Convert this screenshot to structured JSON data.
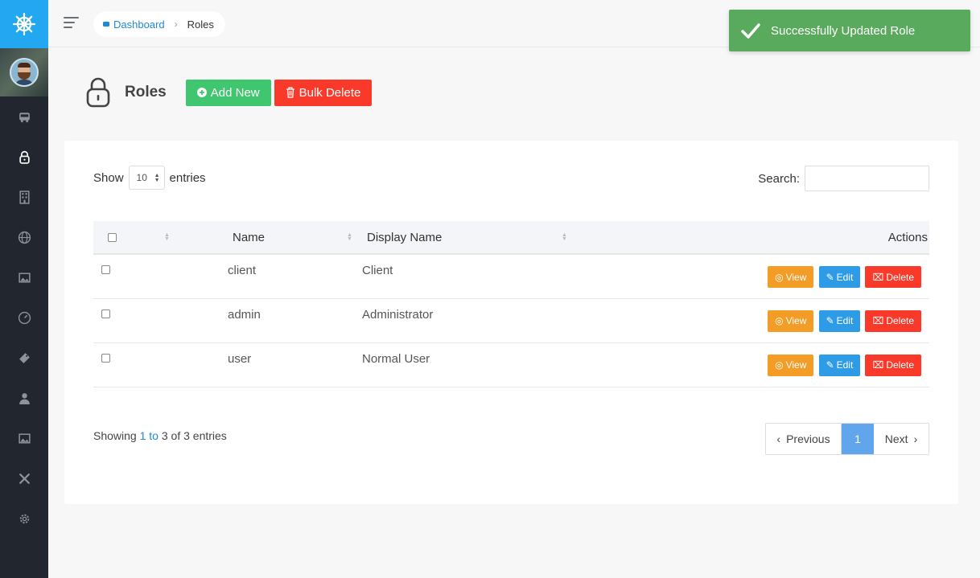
{
  "sidebar": {
    "brand_icon": "ship-wheel-icon",
    "brand_color": "#22a7f0",
    "items": [
      {
        "name": "sidebar-item-bus",
        "icon": "bus-icon"
      },
      {
        "name": "sidebar-item-roles",
        "icon": "lock-icon",
        "active": true
      },
      {
        "name": "sidebar-item-building",
        "icon": "building-icon"
      },
      {
        "name": "sidebar-item-globe",
        "icon": "globe-icon"
      },
      {
        "name": "sidebar-item-media",
        "icon": "image-icon"
      },
      {
        "name": "sidebar-item-dashboard",
        "icon": "gauge-icon"
      },
      {
        "name": "sidebar-item-ticket",
        "icon": "ticket-icon"
      },
      {
        "name": "sidebar-item-users",
        "icon": "user-icon"
      },
      {
        "name": "sidebar-item-gallery",
        "icon": "image-icon"
      },
      {
        "name": "sidebar-item-tools",
        "icon": "tools-icon"
      },
      {
        "name": "sidebar-item-settings",
        "icon": "gear-icon"
      }
    ]
  },
  "topbar": {
    "breadcrumb": {
      "home": "Dashboard",
      "current": "Roles"
    }
  },
  "toast": {
    "message": "Successfully Updated Role",
    "color": "#5aaa5d"
  },
  "page": {
    "title": "Roles",
    "add_label": "Add New",
    "bulk_delete_label": "Bulk Delete"
  },
  "table_controls": {
    "show_label": "Show",
    "entries_value": "10",
    "entries_label": "entries",
    "search_label": "Search:"
  },
  "table": {
    "headers": {
      "name": "Name",
      "display_name": "Display Name",
      "actions": "Actions"
    },
    "rows": [
      {
        "name": "client",
        "display_name": "Client"
      },
      {
        "name": "admin",
        "display_name": "Administrator"
      },
      {
        "name": "user",
        "display_name": "Normal User"
      }
    ],
    "actions": {
      "view": "View",
      "edit": "Edit",
      "delete": "Delete"
    }
  },
  "footer": {
    "info_prefix": "Showing",
    "info_from": "1",
    "info_to_word": "to",
    "info_to": "3",
    "info_of": "of 3 entries",
    "prev_label": "Previous",
    "page": "1",
    "next_label": "Next"
  }
}
